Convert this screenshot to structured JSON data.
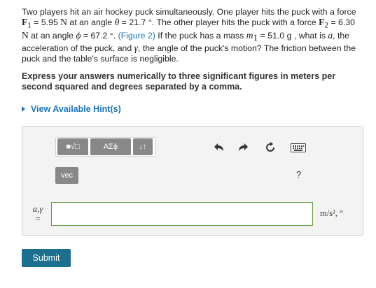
{
  "problem": {
    "p1": "Two players hit an air hockey puck simultaneously. One player hits the puck with a force ",
    "f1_sym": "F",
    "f1_sub": "1",
    "f1_val": " = 5.95 ",
    "unit_n": "N",
    "p2": " at an angle ",
    "theta": "θ",
    "theta_val": " = 21.7 °. The other player hits the puck with a force ",
    "f2_sym": "F",
    "f2_sub": "2",
    "f2_val": " = 6.30 ",
    "p3": " at an angle ",
    "phi": "ϕ",
    "phi_val": " = 67.2 °. ",
    "figure_link": "(Figure 2)",
    "p4": " If the puck has a mass ",
    "m_sym": "m",
    "m_sub": "1",
    "m_val": " = 51.0 g , what is ",
    "a_sym": "a",
    "p5": ", the acceleration of the puck, and ",
    "gamma_sym": "γ",
    "p6": ", the angle of the puck's motion? The friction between the puck and the table's surface is negligible."
  },
  "instructions": "Express your answers numerically to three significant figures in meters per second squared and degrees separated by a comma.",
  "hint_link": "View Available Hint(s)",
  "toolbar": {
    "templates_label": "■√□",
    "greek_label": "ΑΣϕ",
    "arrows_label": "↓↑",
    "vec_label": "vec",
    "help_label": "?"
  },
  "answer": {
    "label_vars": "a,γ",
    "label_eq": "=",
    "value": "",
    "units": "m/s², °"
  },
  "submit_label": "Submit"
}
